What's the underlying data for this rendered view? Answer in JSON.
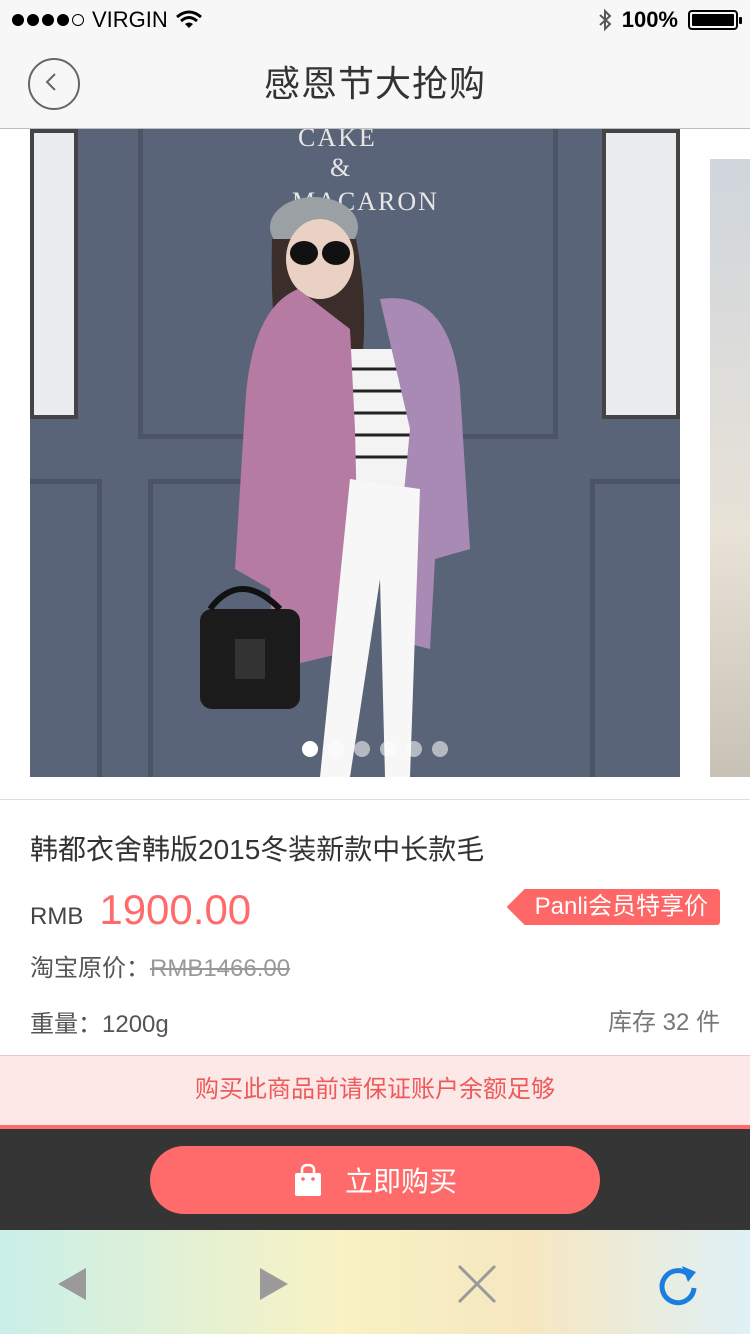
{
  "status_bar": {
    "carrier": "VIRGIN",
    "battery_text": "100%",
    "battery_level": 1.0
  },
  "nav": {
    "title": "感恩节大抢购"
  },
  "gallery": {
    "sign_line1": "CAKE",
    "sign_line2": "&",
    "sign_line3": "MACARON",
    "image_count": 6,
    "active_index": 0
  },
  "product": {
    "title": "韩都衣舍韩版2015冬装新款中长款毛",
    "currency": "RMB",
    "price": "1900.00",
    "member_tag": "Panli会员特享价",
    "original_label": "淘宝原价：",
    "original_price": "RMB1466.00",
    "weight_label": "重量：",
    "weight_value": "1200g",
    "stock": "库存 32 件"
  },
  "notice": "购买此商品前请保证账户余额足够",
  "buy_button": {
    "label": "立即购买"
  },
  "colors": {
    "accent": "#ff6a6a",
    "dark_bar": "#353535",
    "notice_bg": "#fde8e8"
  },
  "browser_toolbar": {
    "icons": [
      "back-arrow-icon",
      "forward-arrow-icon",
      "close-icon",
      "refresh-icon"
    ]
  }
}
